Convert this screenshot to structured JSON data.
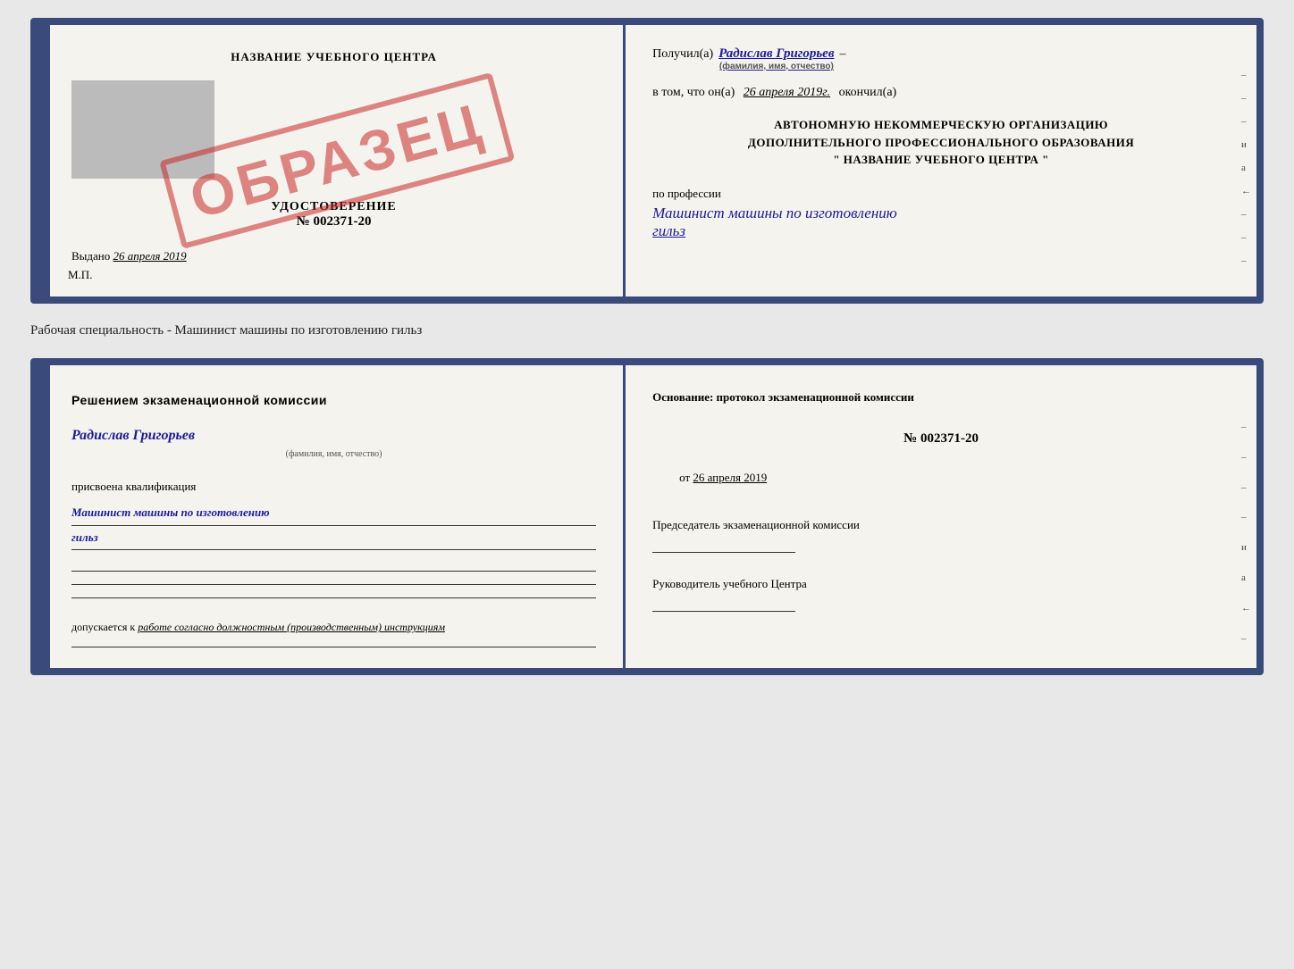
{
  "top_card": {
    "left": {
      "title": "НАЗВАНИЕ УЧЕБНОГО ЦЕНТРА",
      "grey_box": true,
      "udost_label": "УДОСТОВЕРЕНИЕ",
      "udost_number": "№ 002371-20",
      "vydano": "Выдано",
      "vydano_date": "26 апреля 2019",
      "mp": "М.П.",
      "stamp": "ОБРАЗЕЦ"
    },
    "right": {
      "poluchil_prefix": "Получил(а)",
      "poluchil_name": "Радислав Григорьев",
      "poluchil_sub": "(фамилия, имя, отчество)",
      "dash": "–",
      "vtom_prefix": "в том, что он(а)",
      "vtom_date": "26 апреля 2019г.",
      "vtom_suffix": "окончил(а)",
      "org_line1": "АВТОНОМНУЮ НЕКОММЕРЧЕСКУЮ ОРГАНИЗАЦИЮ",
      "org_line2": "ДОПОЛНИТЕЛЬНОГО ПРОФЕССИОНАЛЬНОГО ОБРАЗОВАНИЯ",
      "org_line3": "\" НАЗВАНИЕ УЧЕБНОГО ЦЕНТРА \"",
      "profesia_label": "по профессии",
      "profesia_name": "Машинист машины по изготовлению",
      "profesia_name2": "гильз",
      "side_marks": [
        "–",
        "–",
        "–",
        "и",
        "а",
        "←",
        "–",
        "–",
        "–"
      ]
    }
  },
  "label": "Рабочая специальность - Машинист машины по изготовлению гильз",
  "bottom_card": {
    "left": {
      "resheniem": "Решением  экзаменационной  комиссии",
      "name": "Радислав Григорьев",
      "name_sub": "(фамилия, имя, отчество)",
      "prisvoena": "присвоена квалификация",
      "kvali_name": "Машинист машины по изготовлению",
      "kvali_name2": "гильз",
      "dopuskaetsya": "допускается к",
      "dopusk_italic": "работе согласно должностным (производственным) инструкциям"
    },
    "right": {
      "osnovanie": "Основание: протокол экзаменационной  комиссии",
      "number_label": "№ 002371-20",
      "ot_label": "от",
      "ot_date": "26 апреля 2019",
      "predsedatel_label": "Председатель экзаменационной комиссии",
      "rukovoditel_label": "Руководитель учебного Центра",
      "side_marks": [
        "–",
        "–",
        "–",
        "–",
        "и",
        "а",
        "←",
        "–",
        "–",
        "–",
        "–"
      ]
    }
  }
}
